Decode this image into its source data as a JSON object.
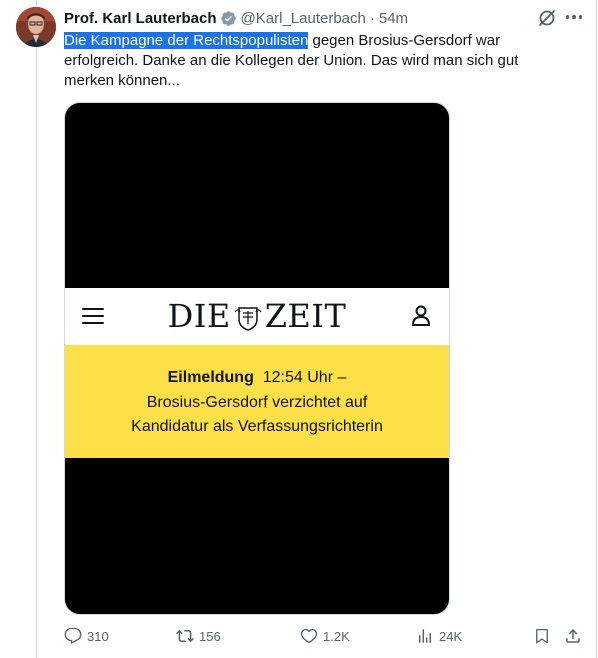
{
  "tweet": {
    "author_name": "Prof. Karl Lauterbach",
    "handle": "@Karl_Lauterbach",
    "separator": "·",
    "time": "54m",
    "text_highlighted": "Die Kampagne der Rechtspopulisten",
    "text_rest": " gegen Brosius-Gersdorf war erfolgreich. Danke an die Kollegen der Union. Das wird man sich gut merken können..."
  },
  "media": {
    "logo_left": "DIE",
    "logo_right": "ZEIT",
    "banner_label": "Eilmeldung",
    "banner_time": "12:54 Uhr –",
    "banner_line2": "Brosius-Gersdorf verzichtet auf",
    "banner_line3": "Kandidatur als Verfassungsrichterin",
    "banner_color": "#fde047"
  },
  "actions": {
    "replies": "310",
    "reposts": "156",
    "likes": "1.2K",
    "views": "24K"
  },
  "colors": {
    "highlight": "#1a73e8",
    "verified": "#829aab",
    "muted": "#536471"
  },
  "icons": [
    "verified-badge-icon",
    "grok-icon",
    "more-icon",
    "menu-icon",
    "user-icon",
    "reply-icon",
    "repost-icon",
    "like-icon",
    "views-icon",
    "bookmark-icon",
    "share-icon"
  ]
}
